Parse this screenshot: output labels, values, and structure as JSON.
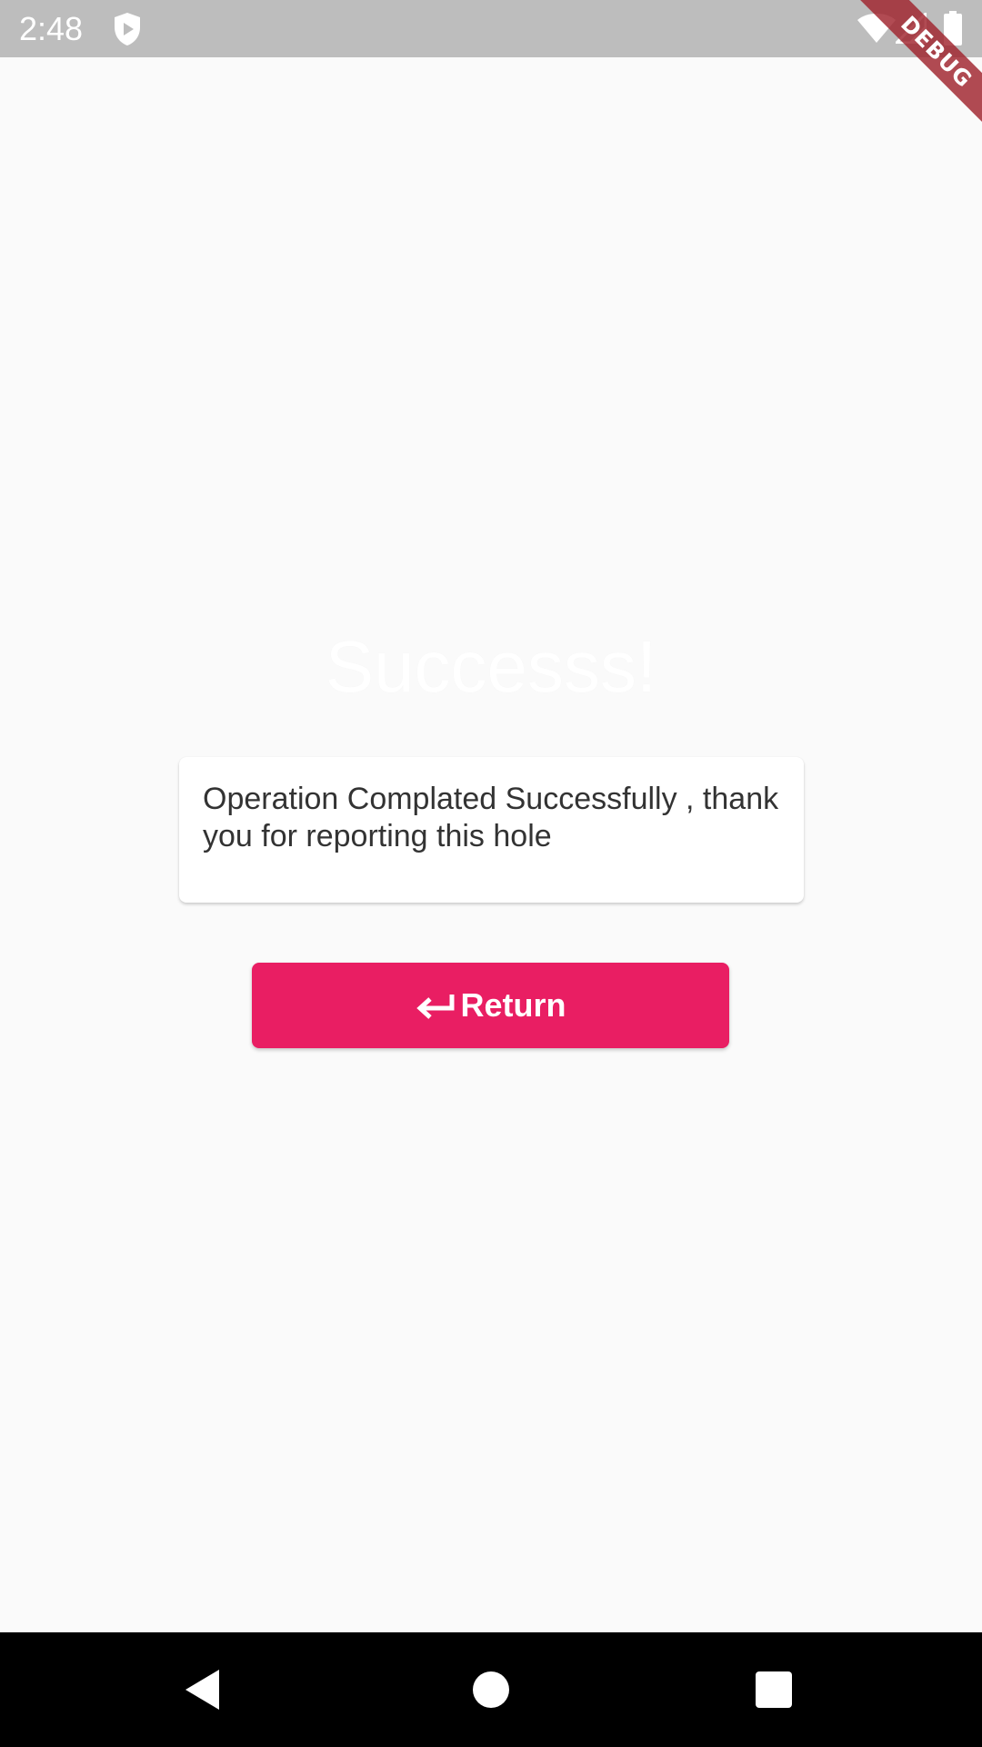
{
  "status_bar": {
    "time": "2:48",
    "icons": [
      "shield-play-icon",
      "wifi-icon",
      "cell-signal-icon",
      "battery-icon"
    ]
  },
  "debug_banner": {
    "label": "DEBUG",
    "color": "#a0232d"
  },
  "main": {
    "title": "Successs!",
    "message": "Operation Complated Successfully , thank you for reporting this hole",
    "return_button": {
      "label": "Return",
      "icon": "keyboard-return-icon",
      "color": "#e91e63"
    }
  },
  "nav_bar": {
    "icons": [
      "back-icon",
      "home-icon",
      "recents-icon"
    ]
  },
  "colors": {
    "background": "#fafafa",
    "status_bar": "#bdbdbd",
    "accent": "#e91e63",
    "text": "#333333"
  }
}
